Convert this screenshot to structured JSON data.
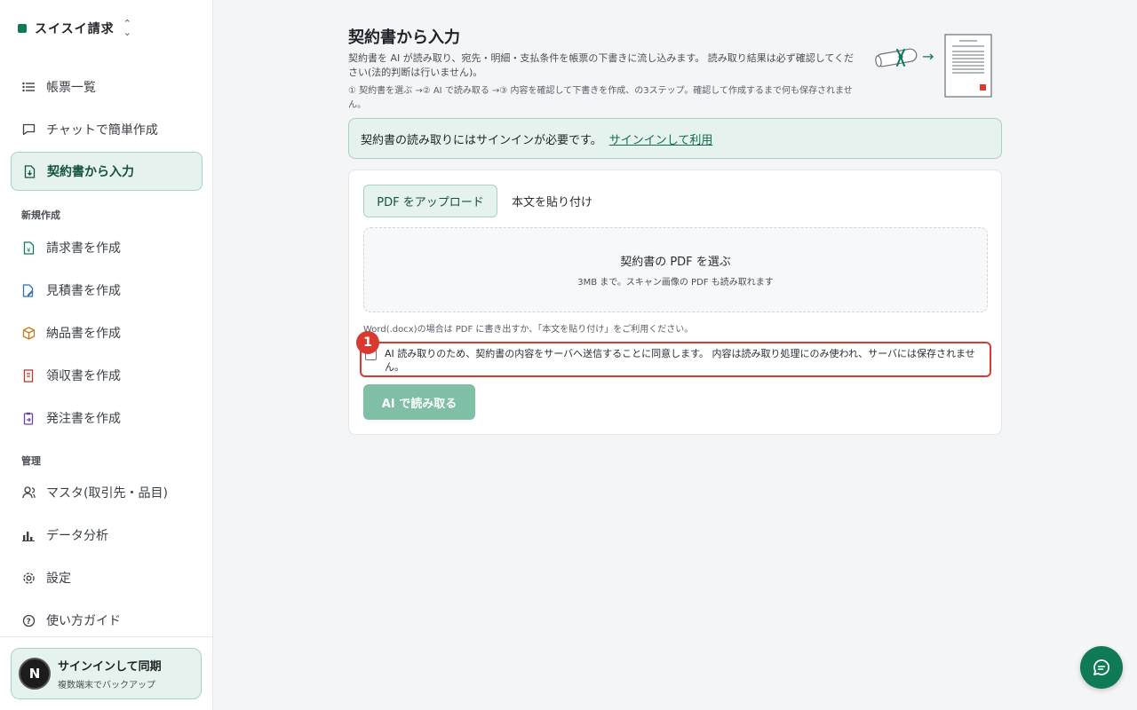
{
  "colors": {
    "brand": "#0f7a55",
    "alert": "#d83a32"
  },
  "sidebar": {
    "brand": "スイスイ請求",
    "items": [
      {
        "label": "帳票一覧",
        "icon": "list-icon"
      },
      {
        "label": "チャットで簡単作成",
        "icon": "chat-bubble-icon"
      },
      {
        "label": "契約書から入力",
        "icon": "document-import-icon",
        "active": true
      }
    ],
    "section_create": "新規作成",
    "create_items": [
      {
        "label": "請求書を作成",
        "icon": "invoice-icon"
      },
      {
        "label": "見積書を作成",
        "icon": "quote-icon"
      },
      {
        "label": "納品書を作成",
        "icon": "box-icon"
      },
      {
        "label": "領収書を作成",
        "icon": "receipt-icon"
      },
      {
        "label": "発注書を作成",
        "icon": "clipboard-icon"
      }
    ],
    "section_manage": "管理",
    "manage_items": [
      {
        "label": "マスタ(取引先・品目)",
        "icon": "user-icon"
      },
      {
        "label": "データ分析",
        "icon": "bar-chart-icon"
      },
      {
        "label": "設定",
        "icon": "gear-icon"
      },
      {
        "label": "使い方ガイド",
        "icon": "help-icon"
      }
    ],
    "signin": {
      "avatar": "N",
      "title": "サインインして同期",
      "subtitle": "複数端末でバックアップ"
    }
  },
  "main": {
    "title": "契約書から入力",
    "lead": "契約書を AI が読み取り、宛先・明細・支払条件を帳票の下書きに流し込みます。 読み取り結果は必ず確認してください(法的判断は行いません)。",
    "steps": "① 契約書を選ぶ →② AI で読み取る →③ 内容を確認して下書きを作成、の3ステップ。確認して作成するまで何も保存されません。",
    "notice": {
      "text": "契約書の読み取りにはサインインが必要です。",
      "link": "サインインして利用"
    },
    "tabs": [
      {
        "label": "PDF をアップロード"
      },
      {
        "label": "本文を貼り付け"
      }
    ],
    "dropzone": {
      "title": "契約書の PDF を選ぶ",
      "subtitle": "3MB まで。スキャン画像の PDF も読み取れます"
    },
    "hint": "Word(.docx)の場合は PDF に書き出すか、「本文を貼り付け」をご利用ください。",
    "consent": {
      "badge": "1",
      "text": "AI 読み取りのため、契約書の内容をサーバへ送信することに同意します。 内容は読み取り処理にのみ使われ、サーバには保存されません。"
    },
    "submit": "AI で読み取る"
  }
}
